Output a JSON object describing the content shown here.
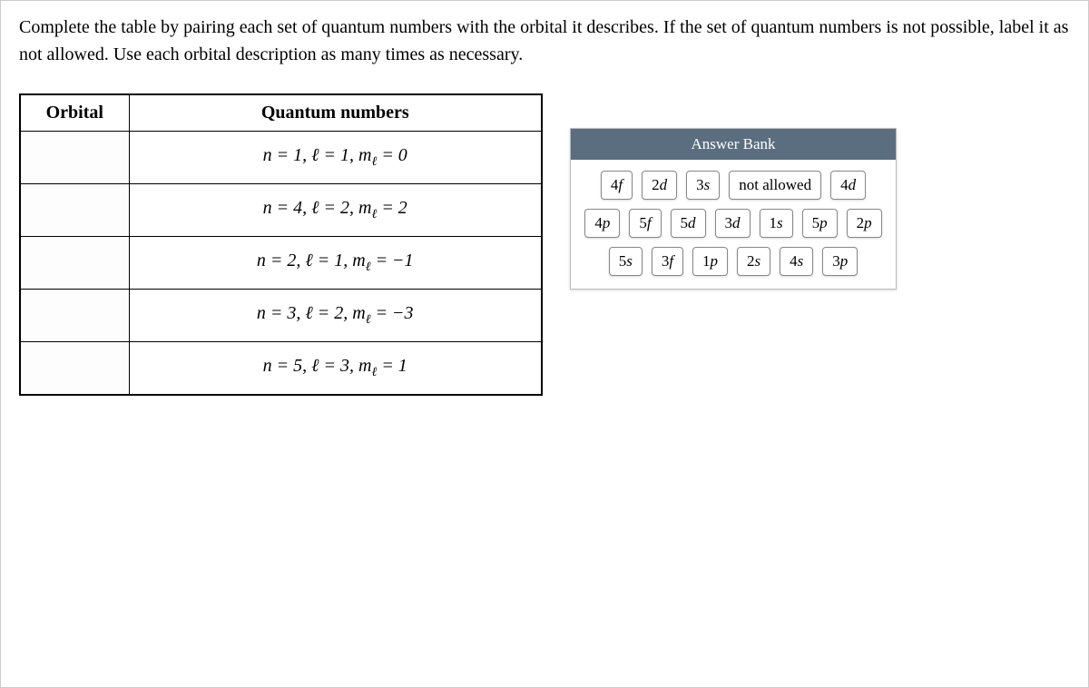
{
  "instructions": "Complete the table by pairing each set of quantum numbers with the orbital it describes. If the set of quantum numbers is not possible, label it as not allowed. Use each orbital description as many times as necessary.",
  "table": {
    "headers": {
      "orbital": "Orbital",
      "qn": "Quantum numbers"
    },
    "rows": [
      {
        "qn": "n = 1, ℓ = 1, mℓ = 0"
      },
      {
        "qn": "n = 4, ℓ = 2, mℓ = 2"
      },
      {
        "qn": "n = 2, ℓ = 1, mℓ = −1"
      },
      {
        "qn": "n = 3, ℓ = 2, mℓ = −3"
      },
      {
        "qn": "n = 5, ℓ = 3, mℓ = 1"
      }
    ]
  },
  "answer_bank": {
    "title": "Answer Bank",
    "tiles_row1": [
      "4f",
      "2d",
      "3s",
      "not allowed"
    ],
    "tiles_row2": [
      "4d",
      "4p",
      "5f",
      "5d",
      "3d"
    ],
    "tiles_row3": [
      "1s",
      "5p",
      "2p",
      "5s",
      "3f"
    ],
    "tiles_row4": [
      "1p",
      "2s",
      "4s",
      "3p"
    ]
  }
}
